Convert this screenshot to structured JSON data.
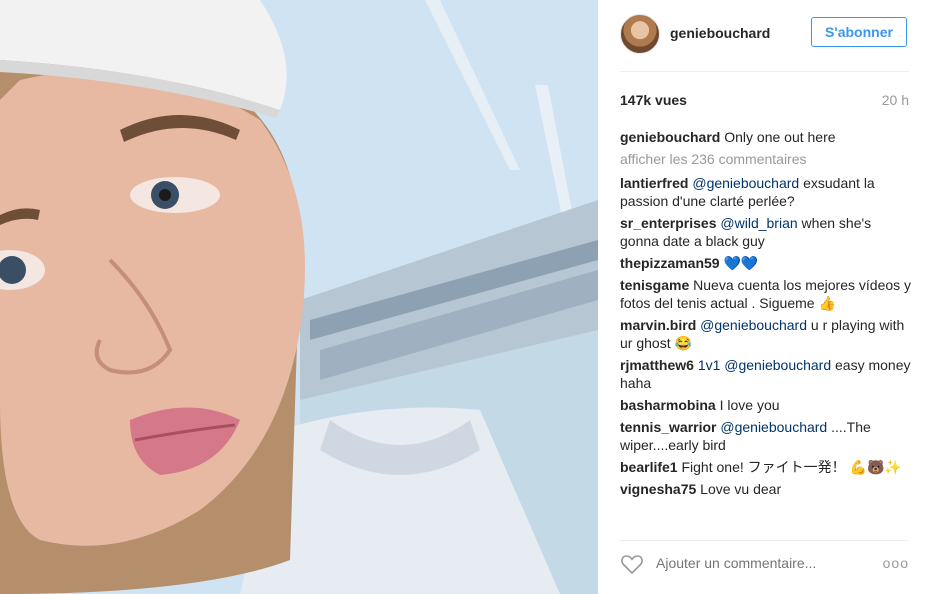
{
  "post": {
    "username": "geniebouchard",
    "follow_label": "S'abonner",
    "views": "147k vues",
    "time": "20 h"
  },
  "comments": {
    "caption": {
      "user": "geniebouchard",
      "text": "Only one out here"
    },
    "load_more": "afficher les 236 commentaires",
    "items": [
      {
        "user": "lantierfred",
        "mention": "@geniebouchard",
        "text": "exsudant la passion d'une clarté perlée?"
      },
      {
        "user": "sr_enterprises",
        "mention": "@wild_brian",
        "text": "when she's gonna date a black guy"
      },
      {
        "user": "thepizzaman59",
        "mention": "",
        "text": "💙💙"
      },
      {
        "user": "tenisgame",
        "mention": "",
        "text": "Nueva cuenta los mejores vídeos y fotos del tenis actual . Sigueme 👍"
      },
      {
        "user": "marvin.bird",
        "mention": "@geniebouchard",
        "text": "u r playing with ur ghost 😂"
      },
      {
        "user": "rjmatthew6",
        "mention": "1v1 @geniebouchard",
        "text": "easy money haha"
      },
      {
        "user": "basharmobina",
        "mention": "",
        "text": "I love you"
      },
      {
        "user": "tennis_warrior",
        "mention": "@geniebouchard",
        "text": "....The wiper....early bird"
      },
      {
        "user": "bearlife1",
        "mention": "",
        "text": "Fight one! ファイト一発！ 💪🐻✨"
      },
      {
        "user": "vignesha75",
        "mention": "",
        "text": "Love vu dear"
      }
    ]
  },
  "footer": {
    "add_comment_placeholder": "Ajouter un commentaire...",
    "more_label": "ooo"
  },
  "icons": {
    "like": "heart-icon",
    "options": "more-options-icon"
  },
  "colors": {
    "accent": "#3897f0",
    "mention": "#003569",
    "muted": "#999999"
  }
}
